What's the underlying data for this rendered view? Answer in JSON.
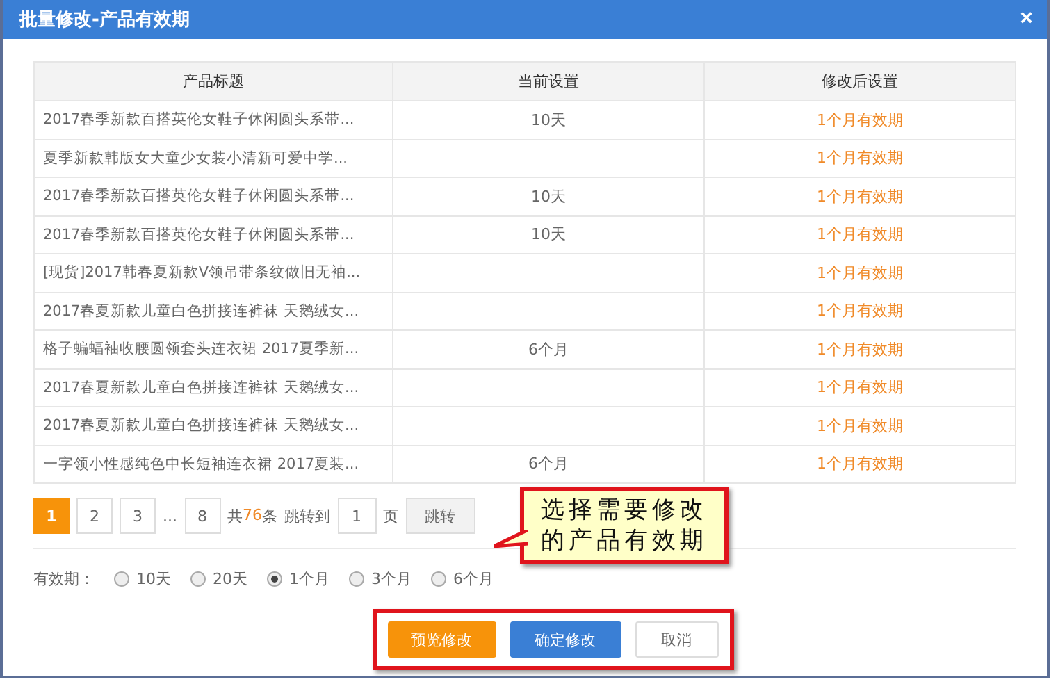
{
  "window": {
    "title": "批量修改-产品有效期",
    "close": "×"
  },
  "table": {
    "columns": [
      "产品标题",
      "当前设置",
      "修改后设置"
    ],
    "rows": [
      {
        "title": "2017春季新款百搭英伦女鞋子休闲圆头系带...",
        "current": "10天",
        "new": "1个月有效期"
      },
      {
        "title": "夏季新款韩版女大童少女装小清新可爱中学...",
        "new": "1个月有效期"
      },
      {
        "title": "2017春季新款百搭英伦女鞋子休闲圆头系带...",
        "current": "10天",
        "new": "1个月有效期"
      },
      {
        "title": "2017春季新款百搭英伦女鞋子休闲圆头系带...",
        "current": "10天",
        "new": "1个月有效期"
      },
      {
        "title": "[现货]2017韩春夏新款V领吊带条纹做旧无袖...",
        "new": "1个月有效期"
      },
      {
        "title": "2017春夏新款儿童白色拼接连裤袜 天鹅绒女...",
        "new": "1个月有效期"
      },
      {
        "title": "格子蝙蝠袖收腰圆领套头连衣裙 2017夏季新...",
        "current": "6个月",
        "new": "1个月有效期"
      },
      {
        "title": "2017春夏新款儿童白色拼接连裤袜 天鹅绒女...",
        "new": "1个月有效期"
      },
      {
        "title": "2017春夏新款儿童白色拼接连裤袜 天鹅绒女...",
        "new": "1个月有效期"
      },
      {
        "title": "一字领小性感纯色中长短袖连衣裙 2017夏装...",
        "current": "6个月",
        "new": "1个月有效期"
      }
    ]
  },
  "pagination": {
    "pages": [
      {
        "label": "1",
        "selected": true
      },
      {
        "label": "2",
        "selected": false
      },
      {
        "label": "3",
        "selected": false
      },
      {
        "label": "8",
        "selected": false
      }
    ],
    "ellipsis": "...",
    "total_prefix": "共",
    "total_count": "76",
    "total_suffix": "条",
    "jump_label": "跳转到",
    "jump_value": "1",
    "page_unit": "页",
    "jump_button": "跳转"
  },
  "validity": {
    "label": "有效期：",
    "options": [
      {
        "label": "10天",
        "selected": false
      },
      {
        "label": "20天",
        "selected": false
      },
      {
        "label": "1个月",
        "selected": true
      },
      {
        "label": "3个月",
        "selected": false
      },
      {
        "label": "6个月",
        "selected": false
      }
    ]
  },
  "callout": {
    "lines": [
      "选择需要修改",
      "的产品有效期"
    ]
  },
  "buttons": [
    {
      "label": "预览修改",
      "kind": "warning"
    },
    {
      "label": "确定修改",
      "kind": "primary"
    },
    {
      "label": "取消",
      "kind": "plain"
    }
  ]
}
